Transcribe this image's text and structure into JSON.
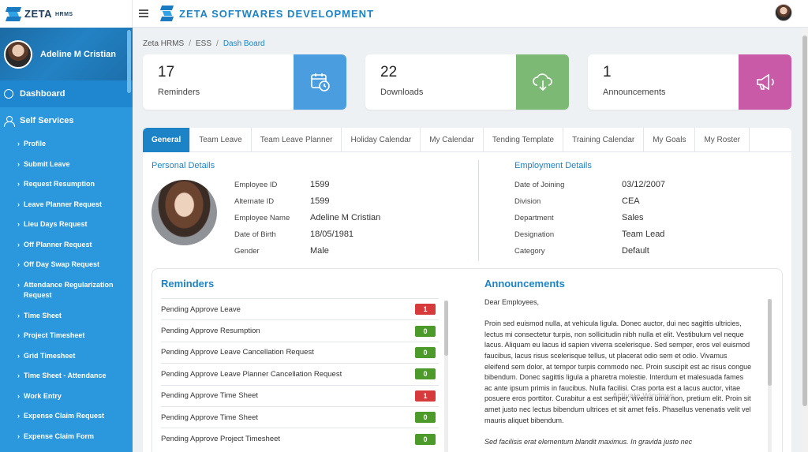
{
  "app": {
    "logo": "ZETA",
    "logo_sub": "HRMS",
    "company": "ZETA SOFTWARES DEVELOPMENT"
  },
  "user": {
    "name": "Adeline M Cristian"
  },
  "sidebar": {
    "main": [
      {
        "label": "Dashboard",
        "icon": "dashboard-icon"
      },
      {
        "label": "Self Services",
        "icon": "user-icon"
      }
    ],
    "sub_items": [
      "Profile",
      "Submit Leave",
      "Request Resumption",
      "Leave Planner Request",
      "Lieu Days Request",
      "Off Planner Request",
      "Off Day Swap Request",
      "Attendance Regularization Request",
      "Time Sheet",
      "Project Timesheet",
      "Grid Timesheet",
      "Time Sheet - Attendance",
      "Work Entry",
      "Expense Claim Request",
      "Expense Claim Form"
    ]
  },
  "breadcrumb": [
    "Zeta HRMS",
    "ESS",
    "Dash Board"
  ],
  "cards": [
    {
      "count": "17",
      "label": "Reminders",
      "color": "#4a9ee0",
      "icon": "alarm-calendar-icon"
    },
    {
      "count": "22",
      "label": "Downloads",
      "color": "#7cb975",
      "icon": "cloud-download-icon"
    },
    {
      "count": "1",
      "label": "Announcements",
      "color": "#c95aa8",
      "icon": "megaphone-icon"
    }
  ],
  "tabs": [
    "General",
    "Team Leave",
    "Team Leave Planner",
    "Holiday Calendar",
    "My Calendar",
    "Tending Template",
    "Training Calendar",
    "My Goals",
    "My Roster"
  ],
  "personal": {
    "title": "Personal Details",
    "rows": [
      {
        "label": "Employee ID",
        "value": "1599"
      },
      {
        "label": "Alternate ID",
        "value": "1599"
      },
      {
        "label": "Employee Name",
        "value": "Adeline M Cristian"
      },
      {
        "label": "Date of Birth",
        "value": "18/05/1981"
      },
      {
        "label": "Gender",
        "value": "Male"
      }
    ]
  },
  "employment": {
    "title": "Employment Details",
    "rows": [
      {
        "label": "Date of Joining",
        "value": "03/12/2007"
      },
      {
        "label": "Division",
        "value": "CEA"
      },
      {
        "label": "Department",
        "value": "Sales"
      },
      {
        "label": "Designation",
        "value": "Team Lead"
      },
      {
        "label": "Category",
        "value": "Default"
      }
    ]
  },
  "reminders": {
    "title": "Reminders",
    "items": [
      {
        "label": "Pending Approve Leave",
        "count": "1",
        "color": "#d63a3a"
      },
      {
        "label": "Pending Approve Resumption",
        "count": "0",
        "color": "#4c9a2a"
      },
      {
        "label": "Pending Approve Leave Cancellation Request",
        "count": "0",
        "color": "#4c9a2a"
      },
      {
        "label": "Pending Approve Leave Planner Cancellation Request",
        "count": "0",
        "color": "#4c9a2a"
      },
      {
        "label": "Pending Approve Time Sheet",
        "count": "1",
        "color": "#d63a3a"
      },
      {
        "label": "Pending Approve Time Sheet",
        "count": "0",
        "color": "#4c9a2a"
      },
      {
        "label": "Pending Approve Project Timesheet",
        "count": "0",
        "color": "#4c9a2a"
      }
    ]
  },
  "announcements": {
    "title": "Announcements",
    "greeting": "Dear Employees,",
    "body": "Proin sed euismod nulla, at vehicula ligula. Donec auctor, dui nec sagittis ultricies, lectus mi consectetur turpis, non sollicitudin nibh nulla et elit. Vestibulum vel neque lacus. Aliquam eu lacus id sapien viverra scelerisque. Sed semper, eros vel euismod faucibus, lacus risus scelerisque tellus, ut placerat odio sem et odio. Vivamus eleifend sem dolor, at tempor turpis commodo nec. Proin suscipit est ac risus congue bibendum. Donec sagittis ligula a pharetra molestie. Interdum et malesuada fames ac ante ipsum primis in faucibus. Nulla facilisi. Cras porta est a lacus auctor, vitae posuere eros porttitor. Curabitur a est semper, viverra urna non, pretium elit. Proin sit amet justo nec lectus bibendum ultrices et sit amet felis. Phasellus venenatis velit vel mauris aliquet bibendum.",
    "tail": "Sed facilisis erat elementum blandit maximus. In gravida justo nec"
  },
  "watermark": "Activate Windows"
}
